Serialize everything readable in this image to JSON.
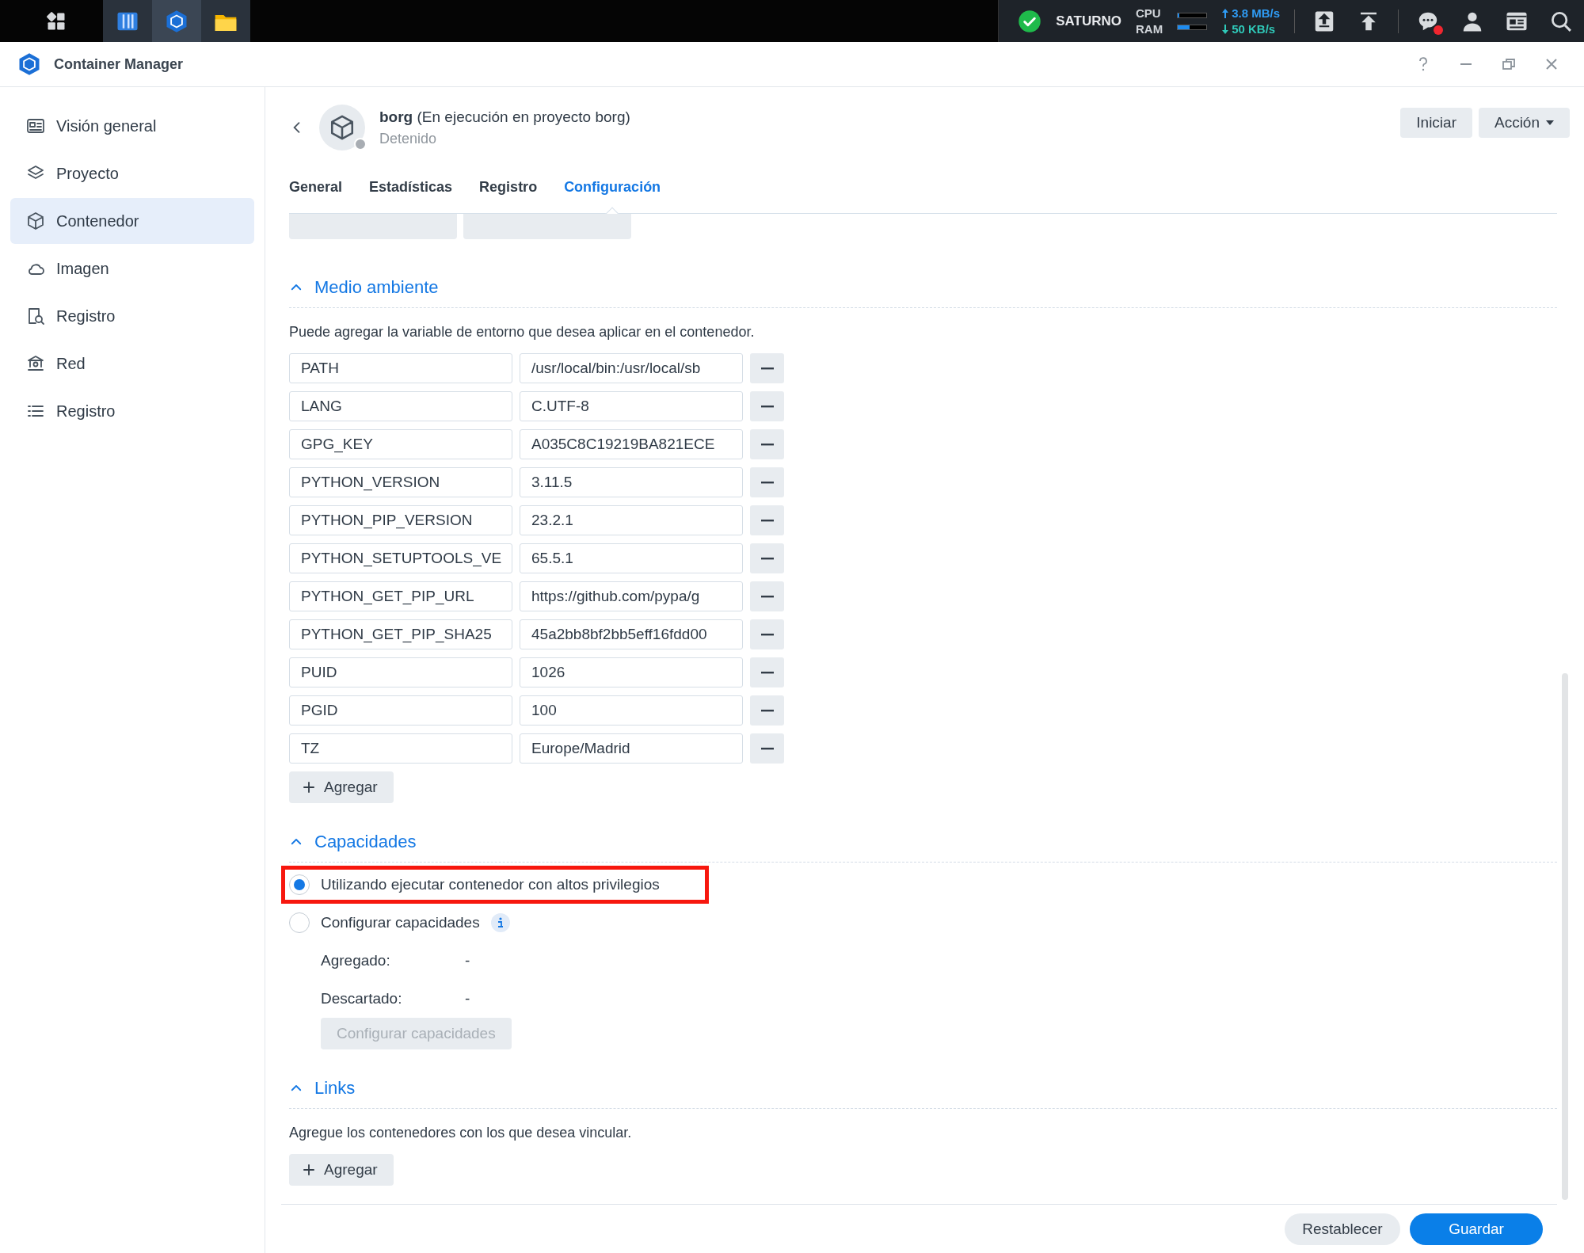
{
  "taskbar": {
    "apps": [
      {
        "kind": "grid",
        "selected": false
      },
      {
        "kind": "panel",
        "selected": false
      },
      {
        "kind": "container",
        "selected": true
      },
      {
        "kind": "folder",
        "selected": false
      }
    ],
    "status": {
      "server": "SATURNO",
      "cpu_label": "CPU",
      "ram_label": "RAM",
      "cpu": {
        "level": 0.05
      },
      "ram": {
        "level": 0.4
      },
      "upload": "3.8 MB/s",
      "download": "50 KB/s",
      "notification": true
    }
  },
  "window": {
    "title": "Container Manager"
  },
  "sidebar": {
    "items": [
      {
        "label": "Visión general",
        "selected": false
      },
      {
        "label": "Proyecto",
        "selected": false
      },
      {
        "label": "Contenedor",
        "selected": true
      },
      {
        "label": "Imagen",
        "selected": false
      },
      {
        "label": "Registro",
        "selected": false
      },
      {
        "label": "Red",
        "selected": false
      },
      {
        "label": "Registro",
        "selected": false
      }
    ]
  },
  "header": {
    "name": "borg",
    "subtitle": "(En ejecución en proyecto borg)",
    "status": "Detenido",
    "running": false,
    "buttons": [
      "Iniciar",
      "Acción"
    ]
  },
  "tabs": [
    {
      "label": "General",
      "selected": false
    },
    {
      "label": "Estadísticas",
      "selected": false
    },
    {
      "label": "Registro",
      "selected": false
    },
    {
      "label": "Configuración",
      "selected": true
    }
  ],
  "environment": {
    "title": "Medio ambiente",
    "expanded": true,
    "description": "Puede agregar la variable de entorno que desea aplicar en el contenedor.",
    "add_label": "Agregar",
    "variables": [
      {
        "name": "PATH",
        "value": "/usr/local/bin:/usr/local/sb"
      },
      {
        "name": "LANG",
        "value": "C.UTF-8"
      },
      {
        "name": "GPG_KEY",
        "value": "A035C8C19219BA821ECE"
      },
      {
        "name": "PYTHON_VERSION",
        "value": "3.11.5"
      },
      {
        "name": "PYTHON_PIP_VERSION",
        "value": "23.2.1"
      },
      {
        "name": "PYTHON_SETUPTOOLS_VE",
        "value": "65.5.1"
      },
      {
        "name": "PYTHON_GET_PIP_URL",
        "value": "https://github.com/pypa/g"
      },
      {
        "name": "PYTHON_GET_PIP_SHA25",
        "value": "45a2bb8bf2bb5eff16fdd00"
      },
      {
        "name": "PUID",
        "value": "1026"
      },
      {
        "name": "PGID",
        "value": "100"
      },
      {
        "name": "TZ",
        "value": "Europe/Madrid"
      }
    ]
  },
  "capabilities": {
    "title": "Capacidades",
    "expanded": true,
    "options": [
      {
        "label": "Utilizando ejecutar contenedor con altos privilegios",
        "selected": true,
        "highlighted": true,
        "info": false
      },
      {
        "label": "Configurar capacidades",
        "selected": false,
        "highlighted": false,
        "info": true
      }
    ],
    "details": [
      {
        "label": "Agregado:",
        "value": "-"
      },
      {
        "label": "Descartado:",
        "value": "-"
      }
    ],
    "button": {
      "label": "Configurar capacidades",
      "disabled": true
    }
  },
  "links": {
    "title": "Links",
    "expanded": true,
    "description": "Agregue los contenedores con los que desea vincular.",
    "add_label": "Agregar"
  },
  "footer": {
    "buttons": [
      {
        "label": "Restablecer",
        "kind": "secondary"
      },
      {
        "label": "Guardar",
        "kind": "primary"
      }
    ]
  }
}
